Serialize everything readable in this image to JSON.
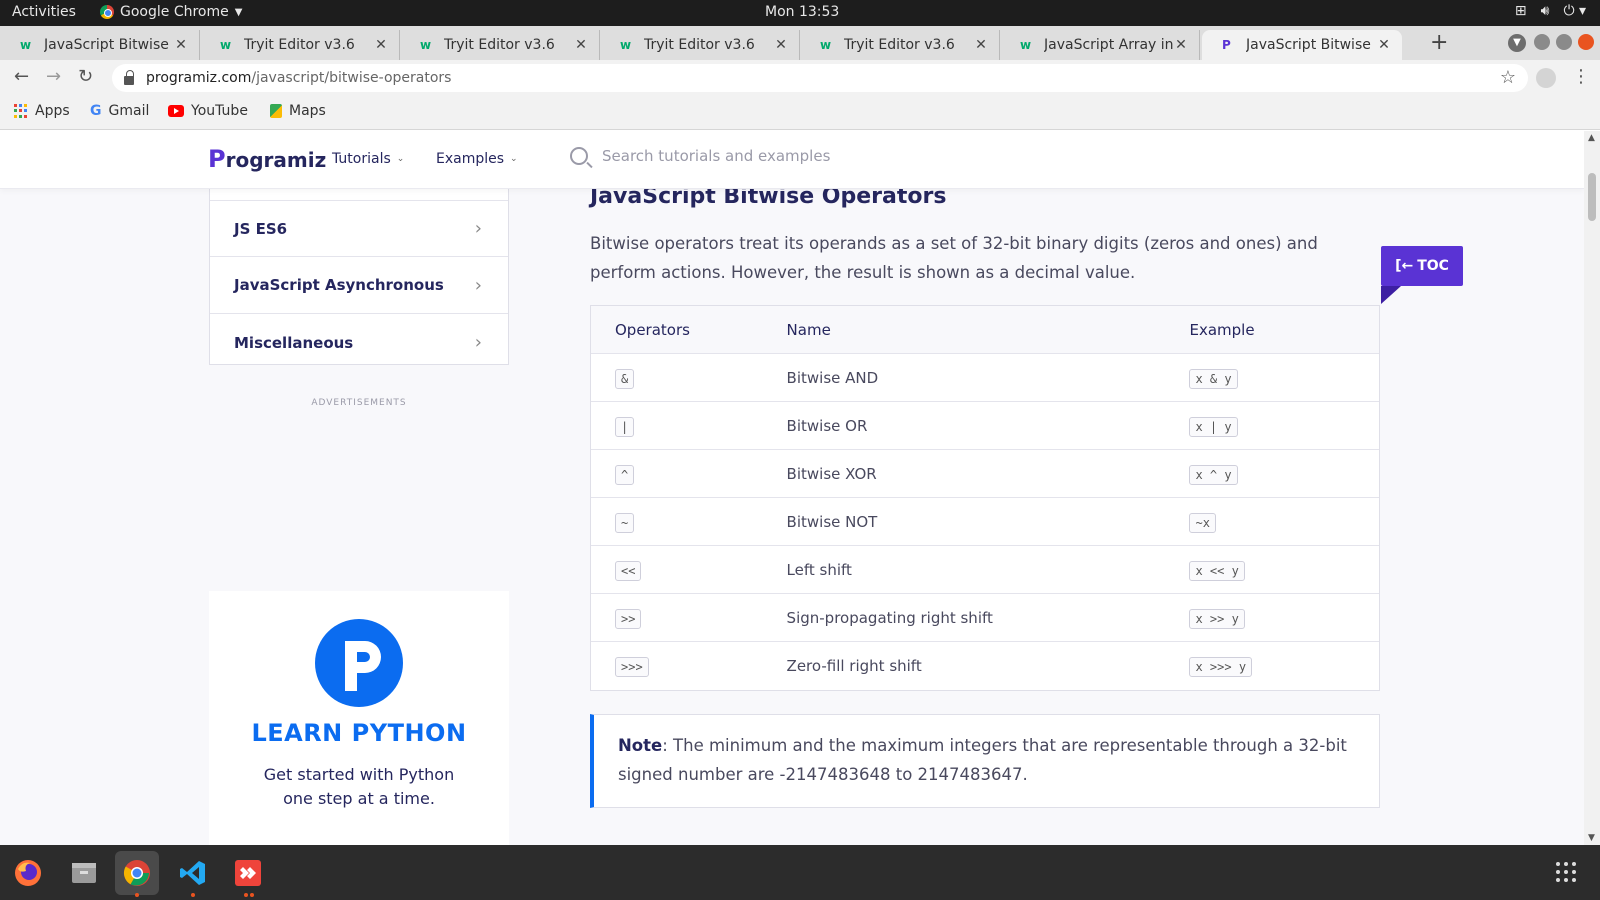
{
  "system_bar": {
    "activities": "Activities",
    "app_name": "Google Chrome",
    "clock": "Mon 13:53"
  },
  "tabs": [
    {
      "label": "JavaScript Bitwise",
      "active": false
    },
    {
      "label": "Tryit Editor v3.6",
      "active": false
    },
    {
      "label": "Tryit Editor v3.6",
      "active": false
    },
    {
      "label": "Tryit Editor v3.6",
      "active": false
    },
    {
      "label": "Tryit Editor v3.6",
      "active": false
    },
    {
      "label": "JavaScript Array ind",
      "active": false
    },
    {
      "label": "JavaScript Bitwise C",
      "active": true
    }
  ],
  "address_bar": {
    "host": "programiz.com",
    "path": "/javascript/bitwise-operators"
  },
  "bookmarks": [
    "Apps",
    "Gmail",
    "YouTube",
    "Maps"
  ],
  "site_nav": {
    "logo": "rogramiz",
    "logo_initial": "P",
    "tutorials": "Tutorials",
    "examples": "Examples",
    "search_placeholder": "Search tutorials and examples"
  },
  "sidebar": {
    "items": [
      {
        "label": "JS ES6"
      },
      {
        "label": "JavaScript Asynchronous"
      },
      {
        "label": "Miscellaneous"
      }
    ],
    "ads_label": "ADVERTISEMENTS"
  },
  "promo": {
    "title": "LEARN PYTHON",
    "subtitle": "Get started with Python one step at a time."
  },
  "article": {
    "title": "JavaScript Bitwise Operators",
    "intro": "Bitwise operators treat its operands as a set of 32-bit binary digits (zeros and ones) and perform actions. However, the result is shown as a decimal value.",
    "table": {
      "headers": [
        "Operators",
        "Name",
        "Example"
      ],
      "rows": [
        {
          "op": "&",
          "name": "Bitwise AND",
          "example": "x & y"
        },
        {
          "op": "|",
          "name": "Bitwise OR",
          "example": "x | y"
        },
        {
          "op": "^",
          "name": "Bitwise XOR",
          "example": "x ^ y"
        },
        {
          "op": "~",
          "name": "Bitwise NOT",
          "example": "~x"
        },
        {
          "op": "<<",
          "name": "Left shift",
          "example": "x << y"
        },
        {
          "op": ">>",
          "name": "Sign-propagating right shift",
          "example": "x >> y"
        },
        {
          "op": ">>>",
          "name": "Zero-fill right shift",
          "example": "x >>> y"
        }
      ]
    },
    "note_label": "Note",
    "note_text": ": The minimum and the maximum integers that are representable through a 32-bit signed number are -2147483648 to 2147483647."
  },
  "toc_label": "TOC",
  "colors": {
    "brand_purple": "#5a33d4",
    "heading_navy": "#25265e",
    "accent_blue": "#0b6cf0",
    "ubuntu_orange": "#e95420"
  }
}
